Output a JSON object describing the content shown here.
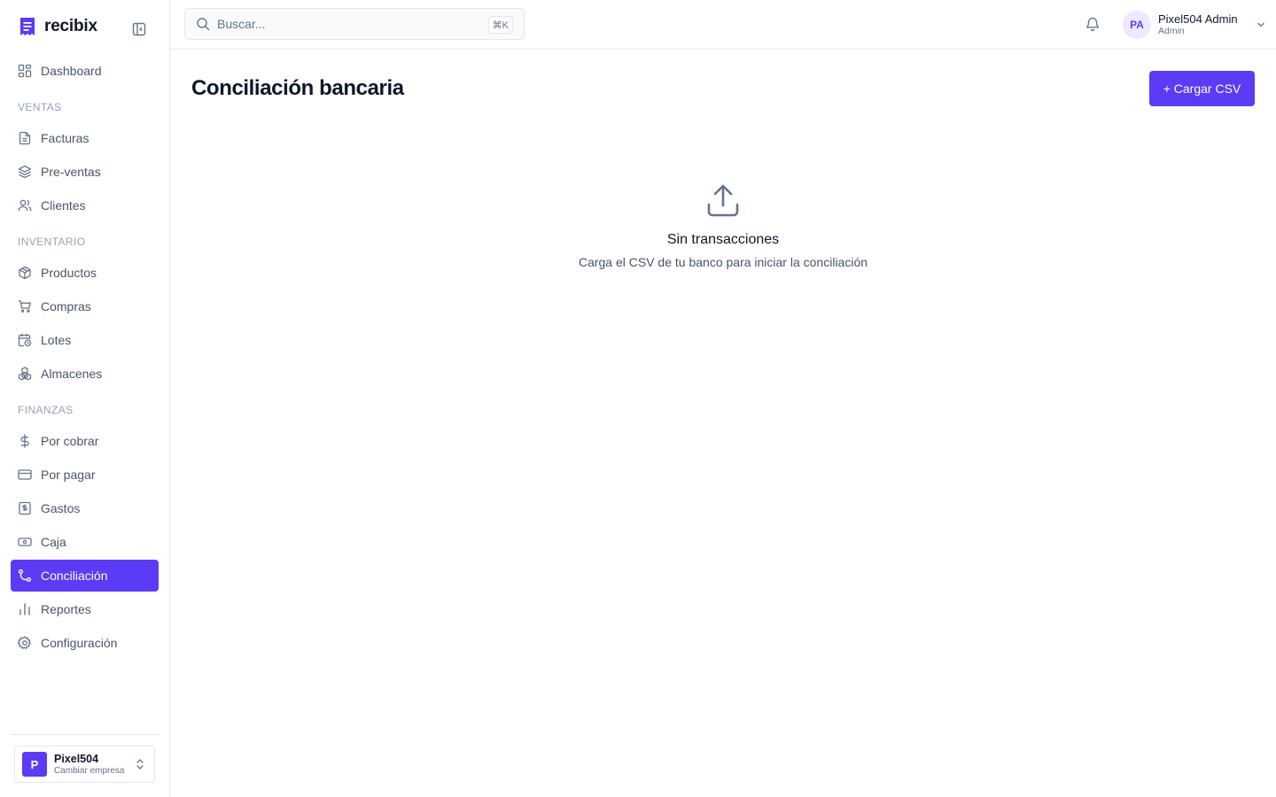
{
  "brand": {
    "name": "recibix",
    "accent": "#5b3bf5"
  },
  "search": {
    "placeholder": "Buscar...",
    "shortcut": "⌘K"
  },
  "user": {
    "initials": "PA",
    "name": "Pixel504 Admin",
    "role": "Admin"
  },
  "sidebar": {
    "dashboard": {
      "label": "Dashboard",
      "icon": "dashboard-icon"
    },
    "sections": [
      {
        "title": "VENTAS",
        "items": [
          {
            "label": "Facturas",
            "icon": "file-icon"
          },
          {
            "label": "Pre-ventas",
            "icon": "layers-icon"
          },
          {
            "label": "Clientes",
            "icon": "users-icon"
          }
        ]
      },
      {
        "title": "INVENTARIO",
        "items": [
          {
            "label": "Productos",
            "icon": "package-icon"
          },
          {
            "label": "Compras",
            "icon": "cart-icon"
          },
          {
            "label": "Lotes",
            "icon": "calendar-clock-icon"
          },
          {
            "label": "Almacenes",
            "icon": "boxes-icon"
          }
        ]
      },
      {
        "title": "FINANZAS",
        "items": [
          {
            "label": "Por cobrar",
            "icon": "dollar-icon"
          },
          {
            "label": "Por pagar",
            "icon": "credit-card-icon"
          },
          {
            "label": "Gastos",
            "icon": "receipt-icon"
          },
          {
            "label": "Caja",
            "icon": "banknote-icon"
          },
          {
            "label": "Conciliación",
            "icon": "git-compare-icon",
            "active": true
          },
          {
            "label": "Reportes",
            "icon": "bar-chart-icon"
          },
          {
            "label": "Configuración",
            "icon": "gear-icon"
          }
        ]
      }
    ]
  },
  "company": {
    "initial": "P",
    "name": "Pixel504",
    "subtitle": "Cambiar empresa"
  },
  "main": {
    "title": "Conciliación bancaria",
    "upload_button": "+ Cargar CSV",
    "empty_title": "Sin transacciones",
    "empty_subtitle": "Carga el CSV de tu banco para iniciar la conciliación"
  }
}
